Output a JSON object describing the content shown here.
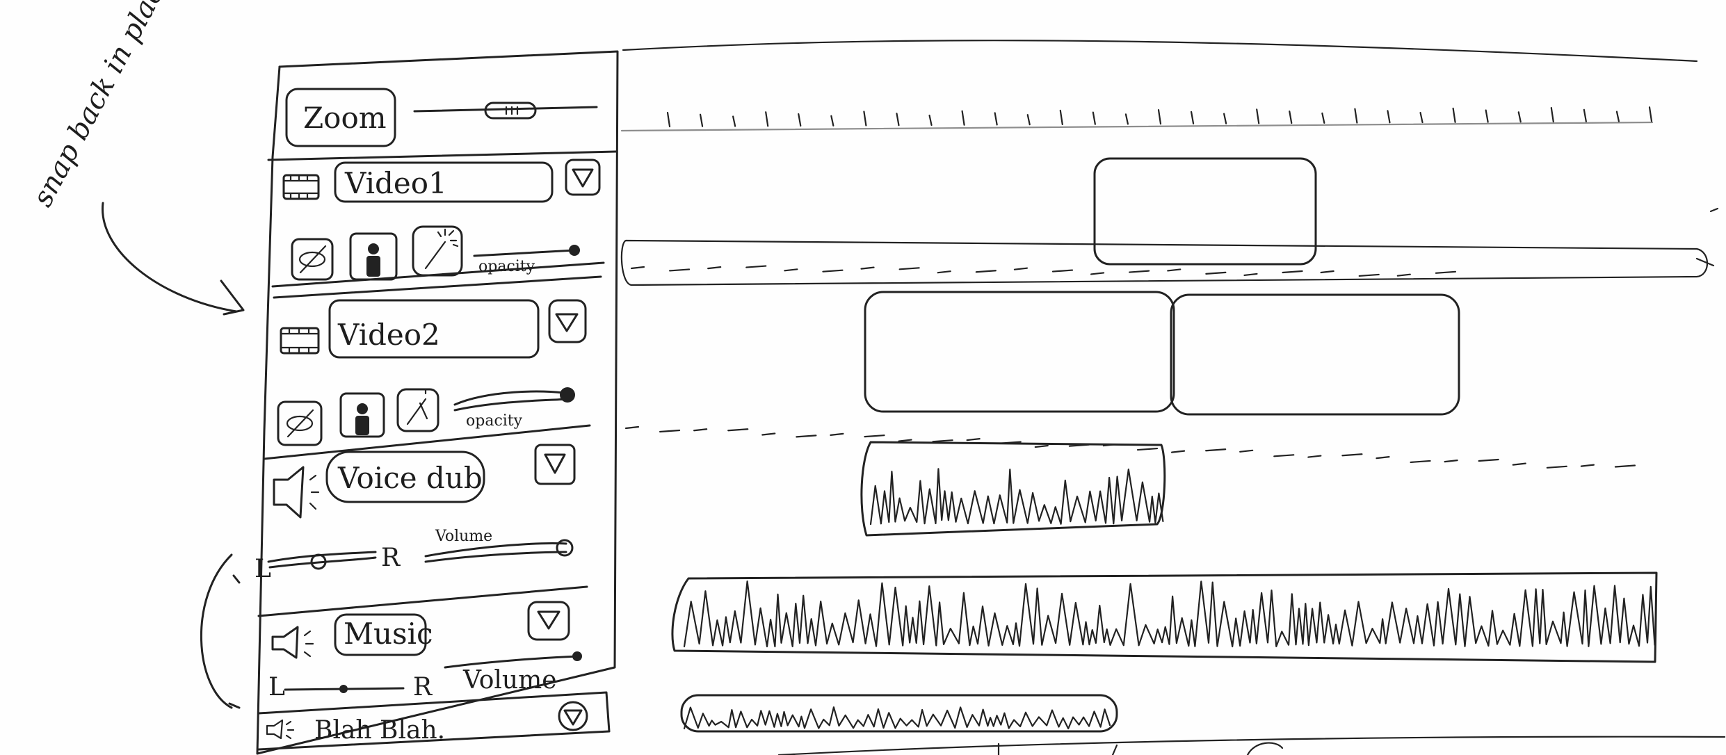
{
  "annotation": {
    "note": "snap back in place"
  },
  "header": {
    "zoom_label": "Zoom"
  },
  "tracks": [
    {
      "id": "video1",
      "type": "video",
      "name": "Video1",
      "opacity_label": "opacity"
    },
    {
      "id": "video2",
      "type": "video",
      "name": "Video2",
      "opacity_label": "opacity"
    },
    {
      "id": "voice",
      "type": "audio",
      "name": "Voice dub",
      "pan_left": "L",
      "pan_right": "R",
      "volume_label": "Volume"
    },
    {
      "id": "music",
      "type": "audio",
      "name": "Music",
      "pan_left": "L",
      "pan_right": "R",
      "volume_label": "Volume"
    },
    {
      "id": "blah",
      "type": "audio",
      "name": "Blah Blah."
    }
  ]
}
